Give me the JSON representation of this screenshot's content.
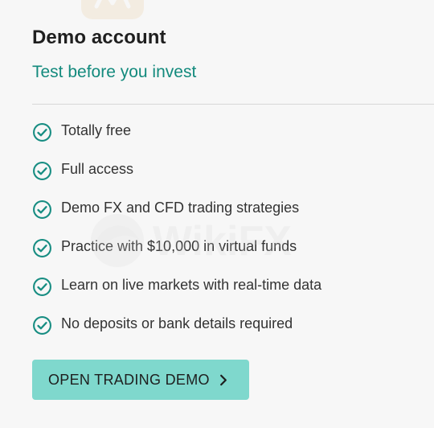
{
  "card": {
    "title": "Demo account",
    "subtitle": "Test before you invest"
  },
  "features": [
    {
      "text": "Totally free"
    },
    {
      "text": "Full access"
    },
    {
      "text": "Demo FX and CFD trading strategies"
    },
    {
      "text": "Practice with $10,000 in virtual funds"
    },
    {
      "text": "Learn on live markets with real-time data"
    },
    {
      "text": "No deposits or bank details required"
    }
  ],
  "button": {
    "label": "OPEN TRADING DEMO"
  },
  "watermark": {
    "text": "WikiFX"
  },
  "colors": {
    "accent_green": "#138a7d",
    "button_bg": "#7fd8cd",
    "check_icon": "#178d82",
    "background": "#f7f7f7"
  }
}
